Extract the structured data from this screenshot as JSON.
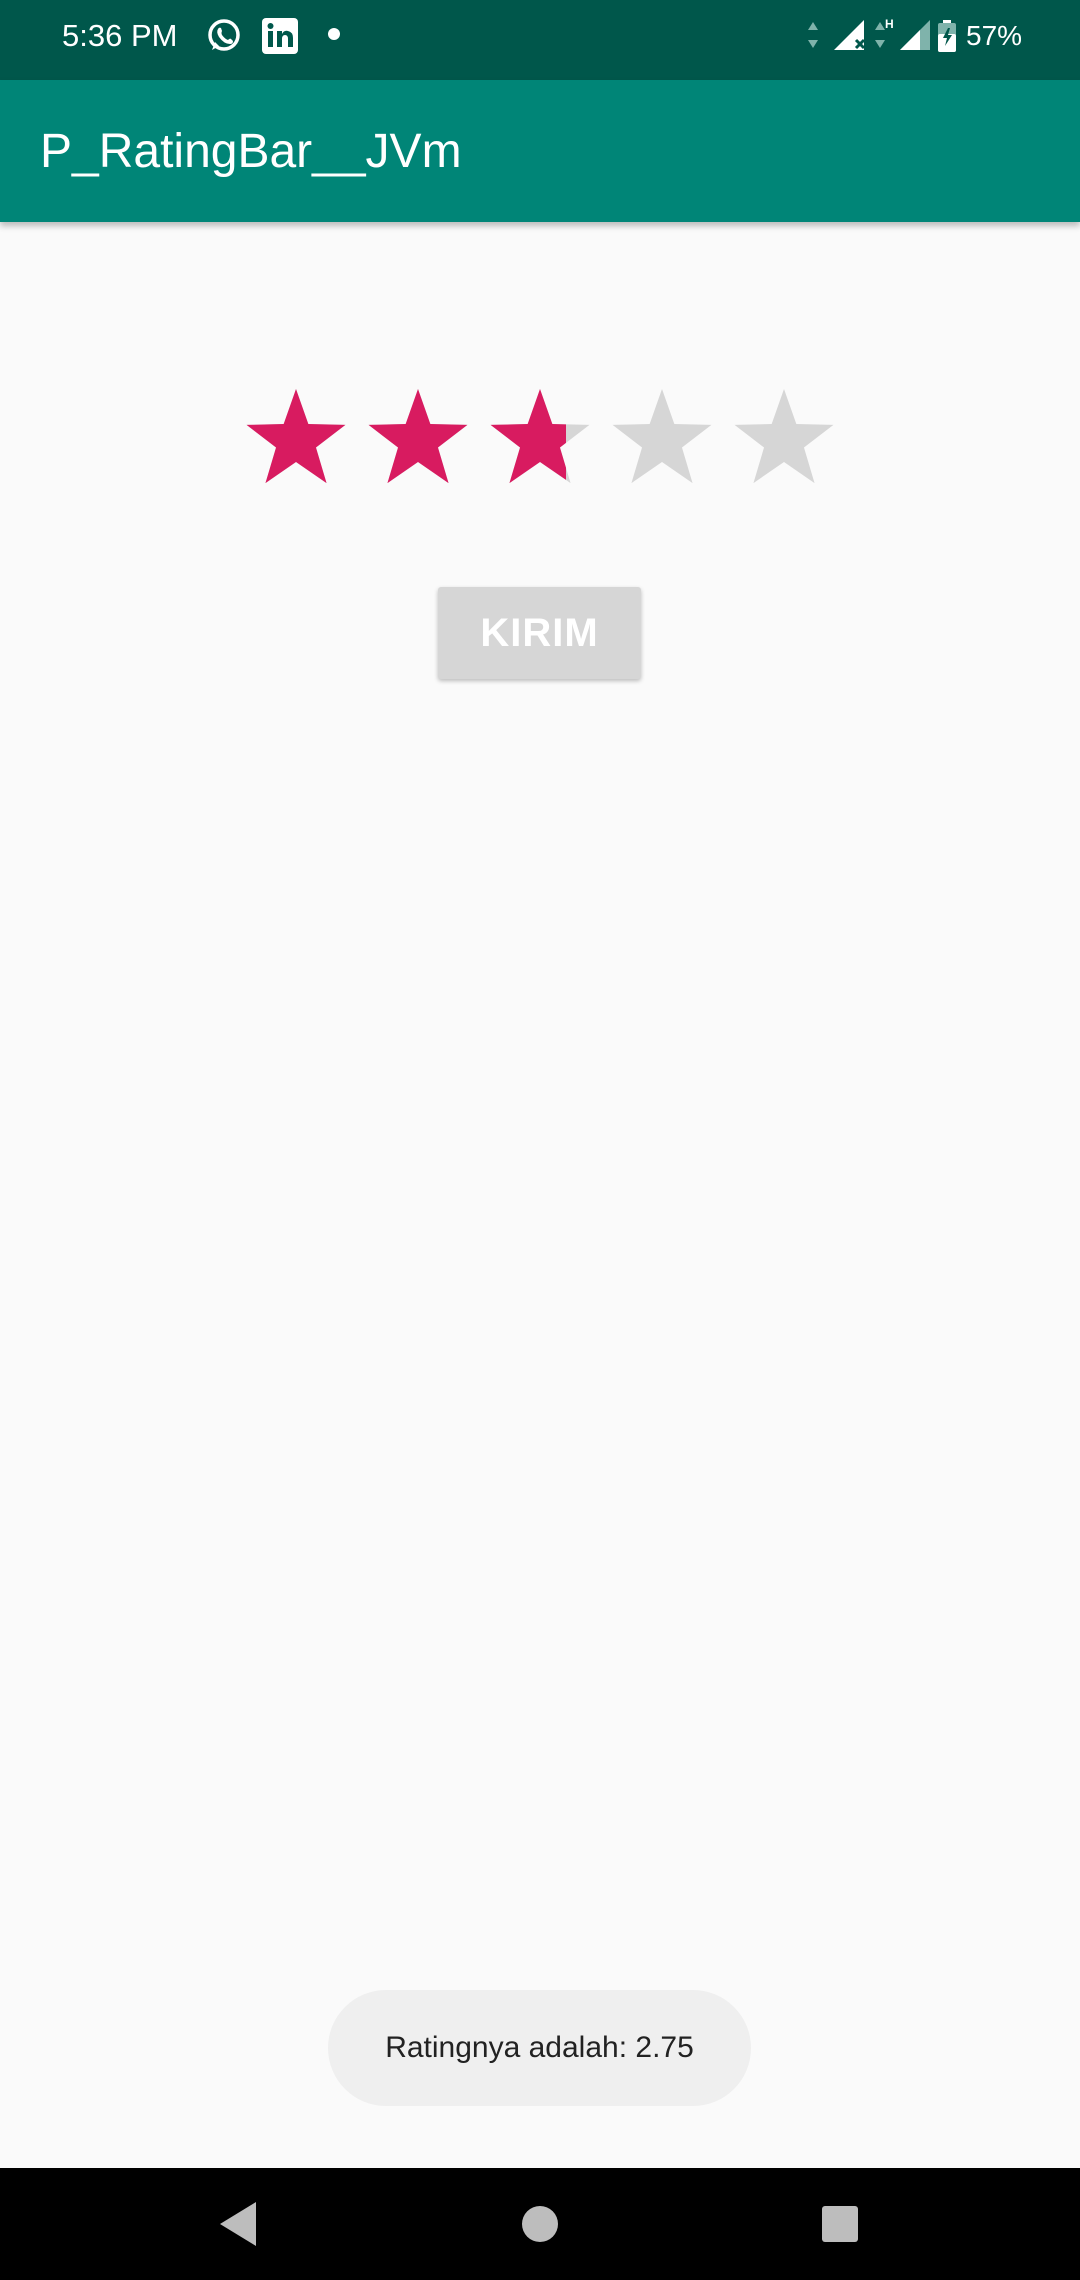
{
  "status_bar": {
    "time": "5:36 PM",
    "battery": "57%",
    "icons": [
      "whatsapp-icon",
      "linkedin-icon",
      "notification-dot",
      "data-arrows-icon",
      "signal-icon",
      "battery-icon"
    ]
  },
  "app_bar": {
    "title": "P_RatingBar__JVm"
  },
  "rating": {
    "value": 2.75,
    "max": 5,
    "filled_color": "#d81b60",
    "empty_color": "#d6d6d6"
  },
  "button": {
    "label": "KIRIM"
  },
  "toast": {
    "text": "Ratingnya adalah: 2.75"
  },
  "colors": {
    "status_bar": "#00574b",
    "app_bar": "#008577",
    "background": "#fafafa",
    "accent": "#d81b60"
  },
  "nav_bar": {
    "icons": [
      "back-icon",
      "home-icon",
      "recents-icon"
    ]
  }
}
